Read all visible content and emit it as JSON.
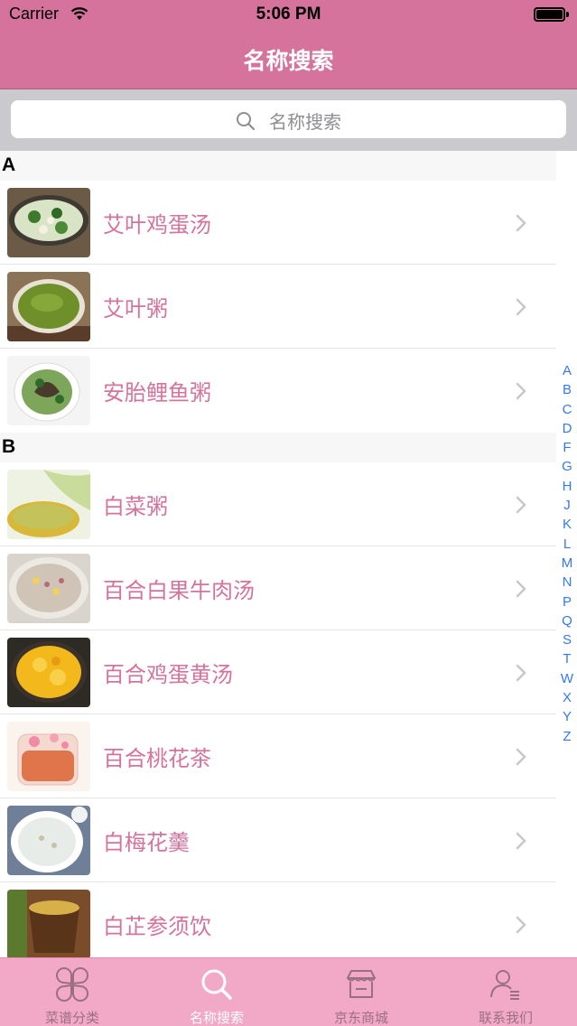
{
  "status": {
    "carrier": "Carrier",
    "time": "5:06 PM"
  },
  "nav": {
    "title": "名称搜索"
  },
  "search": {
    "placeholder": "名称搜索"
  },
  "sections": [
    {
      "letter": "A",
      "items": [
        "艾叶鸡蛋汤",
        "艾叶粥",
        "安胎鲤鱼粥"
      ]
    },
    {
      "letter": "B",
      "items": [
        "白菜粥",
        "百合白果牛肉汤",
        "百合鸡蛋黄汤",
        "百合桃花茶",
        "白梅花羹",
        "白芷参须饮"
      ]
    }
  ],
  "index": [
    "A",
    "B",
    "C",
    "D",
    "F",
    "G",
    "H",
    "J",
    "K",
    "L",
    "M",
    "N",
    "P",
    "Q",
    "S",
    "T",
    "W",
    "X",
    "Y",
    "Z"
  ],
  "tabs": [
    {
      "label": "菜谱分类",
      "icon": "clover-grid-icon"
    },
    {
      "label": "名称搜索",
      "icon": "search-icon"
    },
    {
      "label": "京东商城",
      "icon": "store-icon"
    },
    {
      "label": "联系我们",
      "icon": "contact-person-icon"
    }
  ],
  "colors": {
    "accent": "#d6739c",
    "tabbar": "#f2a9c7",
    "index": "#3478f6"
  }
}
